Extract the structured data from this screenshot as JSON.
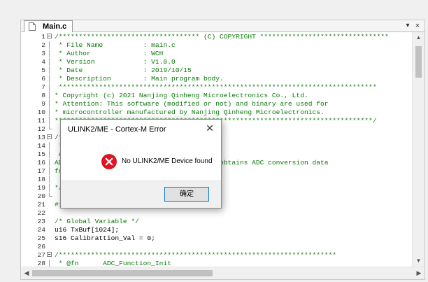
{
  "tab": {
    "label": "Main.c",
    "menu_glyph": "▾",
    "close_glyph": "×"
  },
  "code_lines": [
    {
      "n": "1",
      "fold": "open",
      "text": "/*********************************** (C) COPYRIGHT ********************************",
      "cls": "c-comment"
    },
    {
      "n": "2",
      "fold": "line",
      "text": " * File Name          : main.c",
      "cls": "c-comment"
    },
    {
      "n": "3",
      "fold": "line",
      "text": " * Author             : WCH",
      "cls": "c-comment"
    },
    {
      "n": "4",
      "fold": "line",
      "text": " * Version            : V1.0.0",
      "cls": "c-comment"
    },
    {
      "n": "5",
      "fold": "line",
      "text": " * Date               : 2019/10/15",
      "cls": "c-comment"
    },
    {
      "n": "6",
      "fold": "line",
      "text": " * Description        : Main program body.",
      "cls": "c-comment"
    },
    {
      "n": "7",
      "fold": "line",
      "text": " *******************************************************************************",
      "cls": "c-comment"
    },
    {
      "n": "8",
      "fold": "line",
      "text": "* Copyright (c) 2021 Nanjing Qinheng Microelectronics Co., Ltd.",
      "cls": "c-comment"
    },
    {
      "n": "9",
      "fold": "line",
      "text": "* Attention: This software (modified or not) and binary are used for",
      "cls": "c-comment"
    },
    {
      "n": "10",
      "fold": "line",
      "text": "* microcontroller manufactured by Nanjing Qinheng Microelectronics.",
      "cls": "c-comment"
    },
    {
      "n": "11",
      "fold": "line",
      "text": "*******************************************************************************/",
      "cls": "c-comment"
    },
    {
      "n": "12",
      "fold": "end",
      "text": "",
      "cls": "c-comment"
    },
    {
      "n": "13",
      "fold": "open",
      "text": "/*",
      "cls": "c-comment"
    },
    {
      "n": "14",
      "fold": "line",
      "text": " *@Note",
      "cls": "c-comment"
    },
    {
      "n": "15",
      "fold": "line",
      "text": " ADC DMA",
      "cls": "c-comment"
    },
    {
      "n": "16",
      "fold": "line",
      "text": "ADC channel 2 (PA2), the regular channel obtains ADC conversion data",
      "cls": "c-comment"
    },
    {
      "n": "17",
      "fold": "line",
      "text": "for 1024 times using DMA.",
      "cls": "c-comment"
    },
    {
      "n": "18",
      "fold": "line",
      "text": "",
      "cls": "c-comment"
    },
    {
      "n": "19",
      "fold": "line",
      "text": "*/",
      "cls": "c-comment"
    },
    {
      "n": "20",
      "fold": "end",
      "text": "",
      "cls": "c-comment"
    },
    {
      "n": "21",
      "fold": "none",
      "text": "#include \"debug.h\"",
      "cls": "c-comment"
    },
    {
      "n": "22",
      "fold": "none",
      "text": "",
      "cls": "c-plain"
    },
    {
      "n": "23",
      "fold": "none",
      "text": "/* Global Variable */",
      "cls": "c-comment"
    },
    {
      "n": "24",
      "fold": "none",
      "text": "u16 TxBuf[1024];",
      "cls": "c-plain"
    },
    {
      "n": "25",
      "fold": "none",
      "text": "s16 Calibrattion_Val = 0;",
      "cls": "c-plain"
    },
    {
      "n": "26",
      "fold": "none",
      "text": "",
      "cls": "c-plain"
    },
    {
      "n": "27",
      "fold": "open",
      "text": "/*********************************************************************",
      "cls": "c-comment"
    },
    {
      "n": "28",
      "fold": "line",
      "text": " * @fn      ADC_Function_Init",
      "cls": "c-comment"
    }
  ],
  "dialog": {
    "title": "ULINK2/ME - Cortex-M Error",
    "close_glyph": "✕",
    "message": "No ULINK2/ME Device found",
    "ok_label": "确定",
    "error_color": "#e81123"
  },
  "scroll": {
    "up": "▲",
    "down": "▼",
    "left": "◀",
    "right": "▶"
  }
}
